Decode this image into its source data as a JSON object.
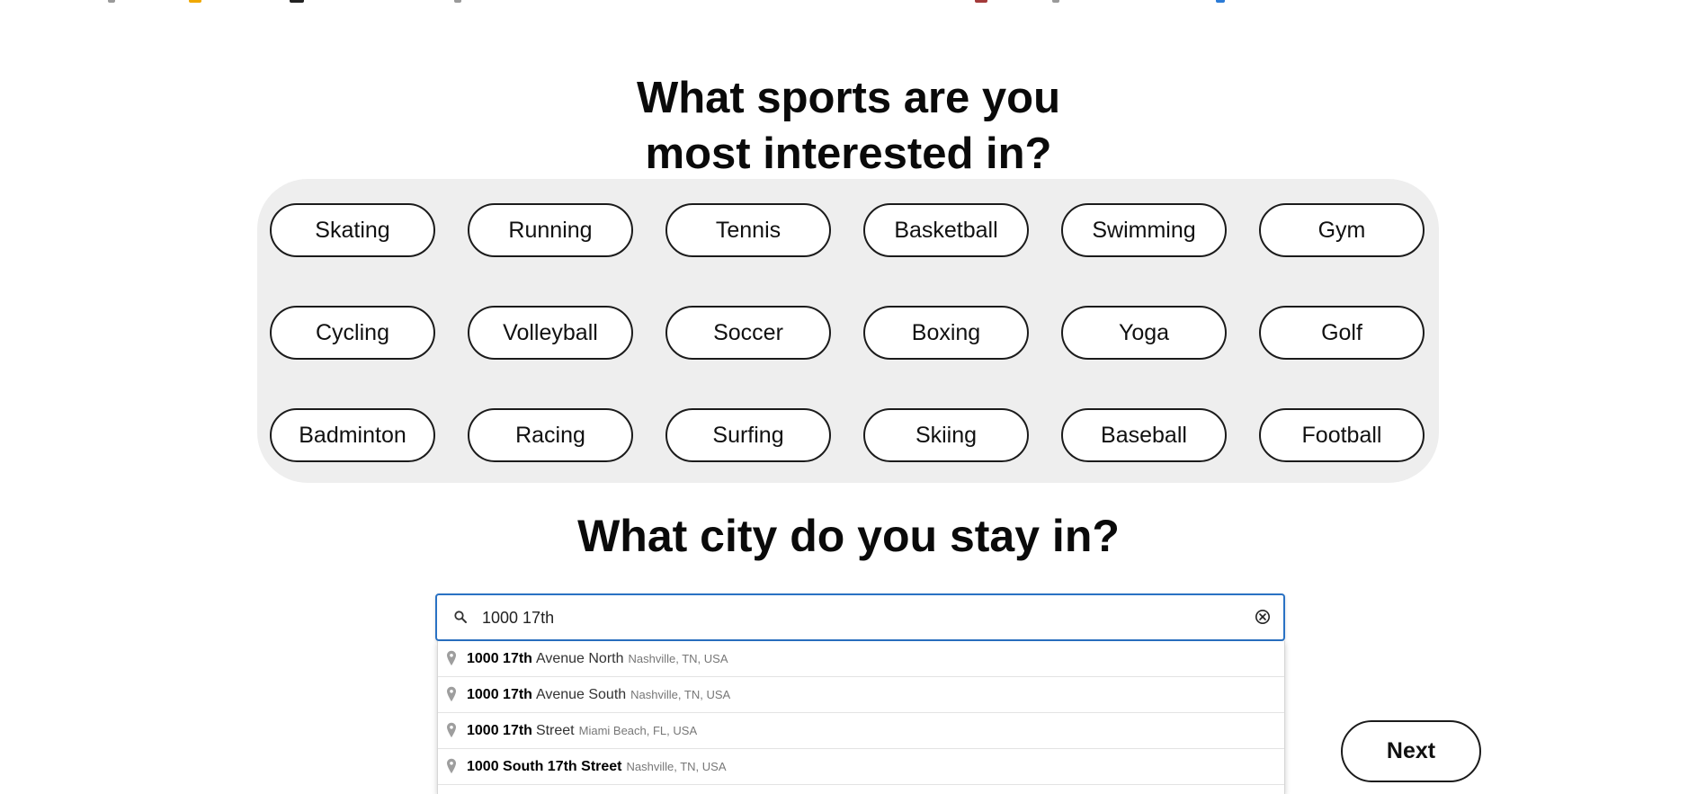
{
  "top_icon_colors": [
    "#9a9a9a",
    "#f0a800",
    "#222222",
    "#9a9a9a",
    "#a33a3a",
    "#9a9a9a",
    "#2b7bd6"
  ],
  "sports_heading_line1": "What sports are you",
  "sports_heading_line2": "most interested in?",
  "sports": [
    [
      "Skating",
      "Running",
      "Tennis",
      "Basketball",
      "Swimming",
      "Gym"
    ],
    [
      "Cycling",
      "Volleyball",
      "Soccer",
      "Boxing",
      "Yoga",
      "Golf"
    ],
    [
      "Badminton",
      "Racing",
      "Surfing",
      "Skiing",
      "Baseball",
      "Football"
    ]
  ],
  "city_heading": "What city do you stay in?",
  "search": {
    "value": "1000 17th",
    "icon": "search-icon",
    "clear_icon": "clear-circle-icon",
    "accent_color": "#2a72c4"
  },
  "suggestions": [
    {
      "match": "1000 17th",
      "rest": "Avenue North",
      "secondary": "Nashville, TN, USA"
    },
    {
      "match": "1000 17th",
      "rest": "Avenue South",
      "secondary": "Nashville, TN, USA"
    },
    {
      "match": "1000 17th",
      "rest": "Street",
      "secondary": "Miami Beach, FL, USA"
    },
    {
      "match": "1000 South 17th Street",
      "rest": "",
      "secondary": "Nashville, TN, USA"
    }
  ],
  "next_label": "Next"
}
